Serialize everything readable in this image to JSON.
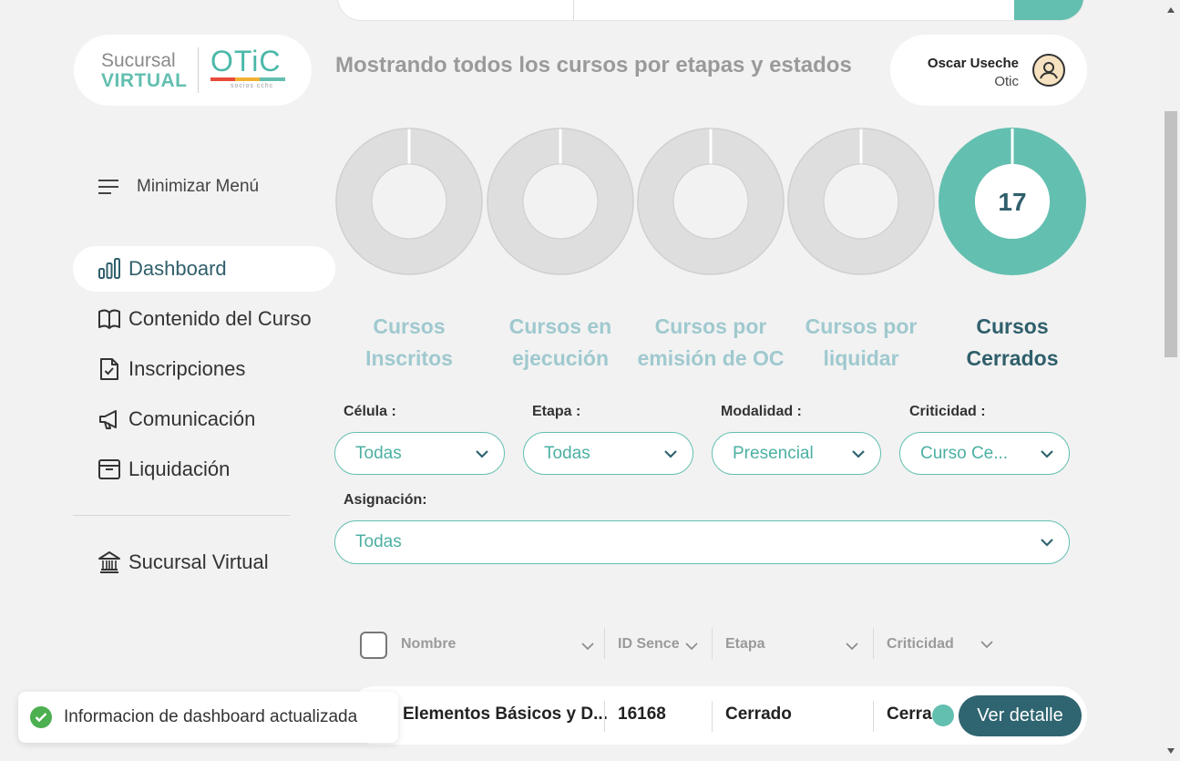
{
  "logo": {
    "line1": "Sucursal",
    "line2": "VIRTUAL",
    "brand": "OTiC",
    "tagline": "socios cchc"
  },
  "header": {
    "title": "Mostrando todos los cursos por etapas y estados"
  },
  "user": {
    "name": "Oscar Useche",
    "org": "Otic"
  },
  "sidebar": {
    "toggle_label": "Minimizar Menú",
    "items": [
      {
        "label": "Dashboard",
        "icon": "bar-chart-icon",
        "active": true
      },
      {
        "label": "Contenido del Curso",
        "icon": "book-icon"
      },
      {
        "label": "Inscripciones",
        "icon": "file-check-icon"
      },
      {
        "label": "Comunicación",
        "icon": "megaphone-icon"
      },
      {
        "label": "Liquidación",
        "icon": "archive-icon"
      }
    ],
    "footer_item": {
      "label": "Sucursal Virtual",
      "icon": "bank-icon"
    }
  },
  "stages": [
    {
      "line1": "Cursos",
      "line2": "Inscritos",
      "count": "",
      "active": false
    },
    {
      "line1": "Cursos en",
      "line2": "ejecución",
      "count": "",
      "active": false
    },
    {
      "line1": "Cursos por",
      "line2": "emisión de OC",
      "count": "",
      "active": false
    },
    {
      "line1": "Cursos por",
      "line2": "liquidar",
      "count": "",
      "active": false
    },
    {
      "line1": "Cursos",
      "line2": "Cerrados",
      "count": "17",
      "active": true
    }
  ],
  "filters": {
    "celula": {
      "label": "Célula :",
      "value": "Todas"
    },
    "etapa": {
      "label": "Etapa :",
      "value": "Todas"
    },
    "modalidad": {
      "label": "Modalidad :",
      "value": "Presencial"
    },
    "criticidad": {
      "label": "Criticidad :",
      "value": "Curso Ce..."
    },
    "asignacion": {
      "label": "Asignación:",
      "value": "Todas"
    }
  },
  "table": {
    "headers": [
      "Nombre",
      "ID Sence",
      "Etapa",
      "Criticidad"
    ],
    "rows": [
      {
        "nombre": "Elementos Básicos y D...",
        "id_sence": "16168",
        "etapa": "Cerrado",
        "criticidad": "Cerra",
        "action": "Ver detalle"
      }
    ]
  },
  "toast": {
    "message": "Informacion de dashboard actualizada"
  },
  "colors": {
    "accent": "#63bfb0",
    "dark": "#2e6570",
    "inactive_ring": "#dedede",
    "label_inactive": "#9fc9cf"
  }
}
